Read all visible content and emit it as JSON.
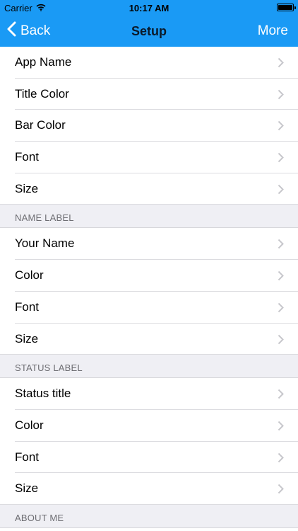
{
  "status_bar": {
    "carrier": "Carrier",
    "time": "10:17 AM"
  },
  "nav": {
    "back_label": "Back",
    "title": "Setup",
    "more_label": "More"
  },
  "section_app": {
    "items": [
      "App Name",
      "Title Color",
      "Bar Color",
      "Font",
      "Size"
    ]
  },
  "section_name": {
    "header": "NAME LABEL",
    "items": [
      "Your Name",
      "Color",
      "Font",
      "Size"
    ]
  },
  "section_status": {
    "header": "STATUS LABEL",
    "items": [
      "Status title",
      "Color",
      "Font",
      "Size"
    ]
  },
  "section_about": {
    "header": "ABOUT ME"
  },
  "colors": {
    "nav_bar": "#1a9af5",
    "group_bg": "#efeff4",
    "chevron": "#c7c7cc"
  }
}
